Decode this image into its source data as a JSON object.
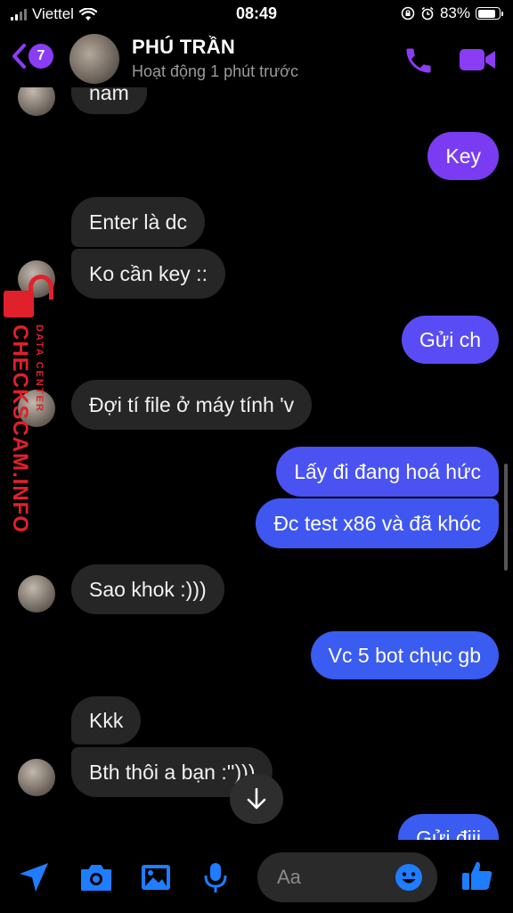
{
  "status_bar": {
    "carrier": "Viettel",
    "time": "08:49",
    "battery": "83%",
    "battery_level": 0.83
  },
  "header": {
    "back_badge": "7",
    "contact_name": "PHÚ TRẦN",
    "active_status": "Hoạt động 1 phút trước"
  },
  "messages": [
    {
      "dir": "in",
      "text": "nam"
    },
    {
      "dir": "out",
      "text": "Key"
    },
    {
      "dir": "in",
      "text": "Enter là dc"
    },
    {
      "dir": "in",
      "text": "Ko cần key ::"
    },
    {
      "dir": "out",
      "text": "Gửi ch"
    },
    {
      "dir": "in",
      "text": "Đợi tí file ở máy tính 'v"
    },
    {
      "dir": "out",
      "text": "Lấy đi đang hoá hức"
    },
    {
      "dir": "out",
      "text": "Đc test x86 và đã khóc"
    },
    {
      "dir": "in",
      "text": "Sao khok :)))"
    },
    {
      "dir": "out",
      "text": "Vc 5 bot chục gb"
    },
    {
      "dir": "in",
      "text": "Kkk"
    },
    {
      "dir": "in",
      "text": "Bth thôi a bạn :'')))"
    },
    {
      "dir": "out",
      "text": "Gửi điii"
    }
  ],
  "watermark": {
    "main": "CHECKSCAM.INFO",
    "sub": "DATA CENTER"
  },
  "composer": {
    "placeholder": "Aa"
  },
  "colors": {
    "accent": "#8b3cf5",
    "bubble_out_blue": "#3a5cf0",
    "bubble_out_purple": "#7a3cf2",
    "bubble_in": "#262626",
    "icon_blue": "#1f7dff"
  },
  "icons": [
    "chevron-left-icon",
    "phone-icon",
    "video-camera-icon",
    "send-arrow-icon",
    "camera-icon",
    "image-icon",
    "microphone-icon",
    "emoji-icon",
    "thumbs-up-icon",
    "arrow-down-icon",
    "lock-icon"
  ]
}
